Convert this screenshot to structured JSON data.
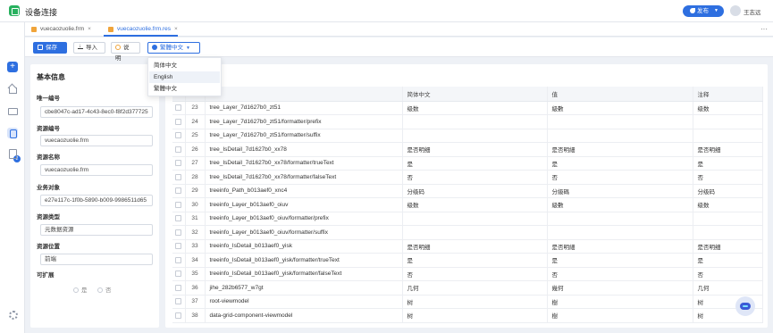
{
  "app": {
    "title": "设备连接",
    "publish_label": "发布",
    "user_name": "王志远"
  },
  "sidebar": {
    "badge_count": "2"
  },
  "tabs": [
    {
      "label": "vuecaozuolie.frm",
      "close": "×"
    },
    {
      "label": "vuecaozuolie.frm.res",
      "close": "×"
    }
  ],
  "tabs_more": "···",
  "toolbar": {
    "save_label": "保存",
    "import_label": "导入",
    "help_label": "说明",
    "language_label": "繁體中文"
  },
  "language_menu": {
    "options": [
      "简体中文",
      "English",
      "繁體中文"
    ],
    "hovered": "English"
  },
  "info": {
    "title": "基本信息",
    "fields": [
      {
        "label": "唯一编号",
        "value": "cbe8047c-ad17-4c43-8ec0-f8f2d377725"
      },
      {
        "label": "资源编号",
        "value": "vuecaozuolie.frm"
      },
      {
        "label": "资源名称",
        "value": "vuecaozuolie.frm"
      },
      {
        "label": "业务对象",
        "value": "e27e117c-1f0b-5890-b009-9986511d65"
      },
      {
        "label": "资源类型",
        "value": "元数据资源"
      },
      {
        "label": "资源位置",
        "value": "前端"
      }
    ],
    "extensible_label": "可扩展",
    "extensible_yes": "是",
    "extensible_no": "否"
  },
  "table": {
    "headers": [
      "",
      "",
      "简体中文",
      "值",
      "注释"
    ],
    "rows": [
      {
        "n": "23",
        "key": "tree_Layer_7d1627b0_zt51",
        "zh": "级数",
        "val": "級數",
        "note": "级数"
      },
      {
        "n": "24",
        "key": "tree_Layer_7d1627b0_zt51/formatter/prefix",
        "zh": "",
        "val": "",
        "note": ""
      },
      {
        "n": "25",
        "key": "tree_Layer_7d1627b0_zt51/formatter/suffix",
        "zh": "",
        "val": "",
        "note": ""
      },
      {
        "n": "26",
        "key": "tree_IsDetail_7d1627b0_xx78",
        "zh": "是否明细",
        "val": "是否明細",
        "note": "是否明细"
      },
      {
        "n": "27",
        "key": "tree_IsDetail_7d1627b0_xx78/formatter/trueText",
        "zh": "是",
        "val": "是",
        "note": "是"
      },
      {
        "n": "28",
        "key": "tree_IsDetail_7d1627b0_xx78/formatter/falseText",
        "zh": "否",
        "val": "否",
        "note": "否"
      },
      {
        "n": "29",
        "key": "treeinfo_Path_b013aef0_xnc4",
        "zh": "分级码",
        "val": "分級碼",
        "note": "分级码"
      },
      {
        "n": "30",
        "key": "treeinfo_Layer_b013aef0_oiuv",
        "zh": "级数",
        "val": "級數",
        "note": "级数"
      },
      {
        "n": "31",
        "key": "treeinfo_Layer_b013aef0_oiuv/formatter/prefix",
        "zh": "",
        "val": "",
        "note": ""
      },
      {
        "n": "32",
        "key": "treeinfo_Layer_b013aef0_oiuv/formatter/suffix",
        "zh": "",
        "val": "",
        "note": ""
      },
      {
        "n": "33",
        "key": "treeinfo_IsDetail_b013aef0_yisk",
        "zh": "是否明细",
        "val": "是否明細",
        "note": "是否明细"
      },
      {
        "n": "34",
        "key": "treeinfo_IsDetail_b013aef0_yisk/formatter/trueText",
        "zh": "是",
        "val": "是",
        "note": "是"
      },
      {
        "n": "35",
        "key": "treeinfo_IsDetail_b013aef0_yisk/formatter/falseText",
        "zh": "否",
        "val": "否",
        "note": "否"
      },
      {
        "n": "36",
        "key": "jihe_282b6577_w7gt",
        "zh": "几何",
        "val": "幾何",
        "note": "几何"
      },
      {
        "n": "37",
        "key": "root-viewmodel",
        "zh": "树",
        "val": "樹",
        "note": "树"
      },
      {
        "n": "38",
        "key": "data-grid-component-viewmodel",
        "zh": "树",
        "val": "樹",
        "note": "树"
      }
    ]
  },
  "colors": {
    "primary": "#2e6fe0",
    "app_green": "#27b15e",
    "tab_file": "#f0a43a"
  }
}
